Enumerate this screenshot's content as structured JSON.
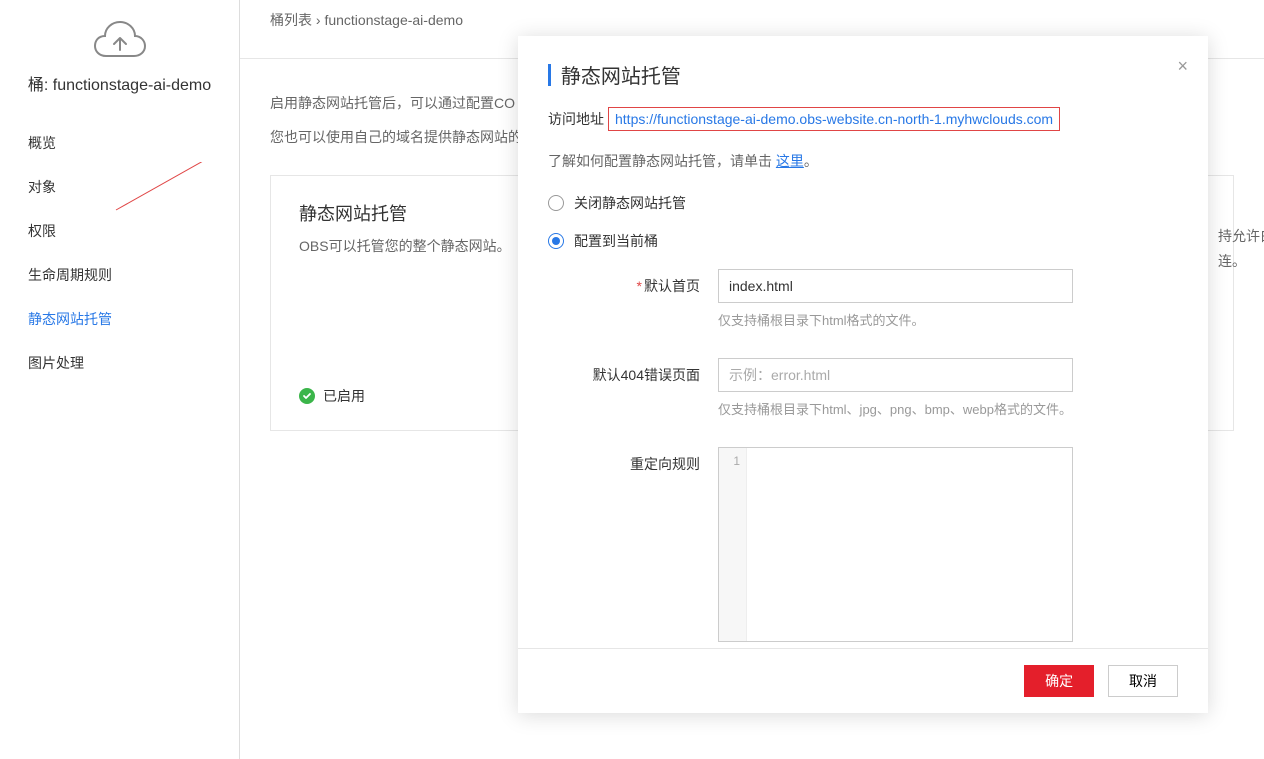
{
  "sidebar": {
    "bucket_label": "桶: functionstage-ai-demo",
    "nav": [
      {
        "label": "概览"
      },
      {
        "label": "对象"
      },
      {
        "label": "权限"
      },
      {
        "label": "生命周期规则"
      },
      {
        "label": "静态网站托管"
      },
      {
        "label": "图片处理"
      }
    ]
  },
  "breadcrumb": {
    "root": "桶列表",
    "sep": " › ",
    "current": "functionstage-ai-demo"
  },
  "content": {
    "line1": "启用静态网站托管后，可以通过配置CO",
    "line2": "您也可以使用自己的域名提供静态网站的",
    "panel_title": "静态网站托管",
    "panel_desc": "OBS可以托管您的整个静态网站。",
    "status_label": "已启用",
    "right1": "持允许白",
    "right2": "连。"
  },
  "modal": {
    "title": "静态网站托管",
    "access_label": "访问地址",
    "access_url": "https://functionstage-ai-demo.obs-website.cn-north-1.myhwclouds.com",
    "help_prefix": "了解如何配置静态网站托管，请单击 ",
    "help_link": "这里",
    "help_suffix": "。",
    "radio_off": "关闭静态网站托管",
    "radio_on": "配置到当前桶",
    "form": {
      "index_label": "默认首页",
      "index_value": "index.html",
      "index_hint": "仅支持桶根目录下html格式的文件。",
      "error_label": "默认404错误页面",
      "error_placeholder": "示例：error.html",
      "error_hint": "仅支持桶根目录下html、jpg、png、bmp、webp格式的文件。",
      "redirect_label": "重定向规则",
      "gutter": "1"
    },
    "ok": "确定",
    "cancel": "取消"
  }
}
